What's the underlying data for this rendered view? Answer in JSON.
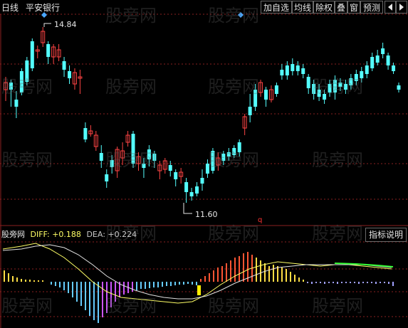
{
  "header": {
    "period": "日线",
    "stock_name": "平安银行",
    "buttons": [
      "加自选",
      "均线",
      "除权",
      "叠",
      "窗",
      "预测"
    ]
  },
  "price_panel": {
    "high_label": "14.84",
    "low_label": "11.60",
    "marker_label": "q"
  },
  "indicator_panel": {
    "name": "股旁网",
    "diff_text": "DIFF: +0.188",
    "dea_text": "DEA: +0.224",
    "help_label": "指标说明"
  },
  "watermark": "股旁网",
  "colors": {
    "up": "#ff4444",
    "down": "#54ffff",
    "diff": "#ffff66",
    "dea": "#e0e0e0",
    "grid": "#8a1f1f",
    "background": "#000000"
  }
}
